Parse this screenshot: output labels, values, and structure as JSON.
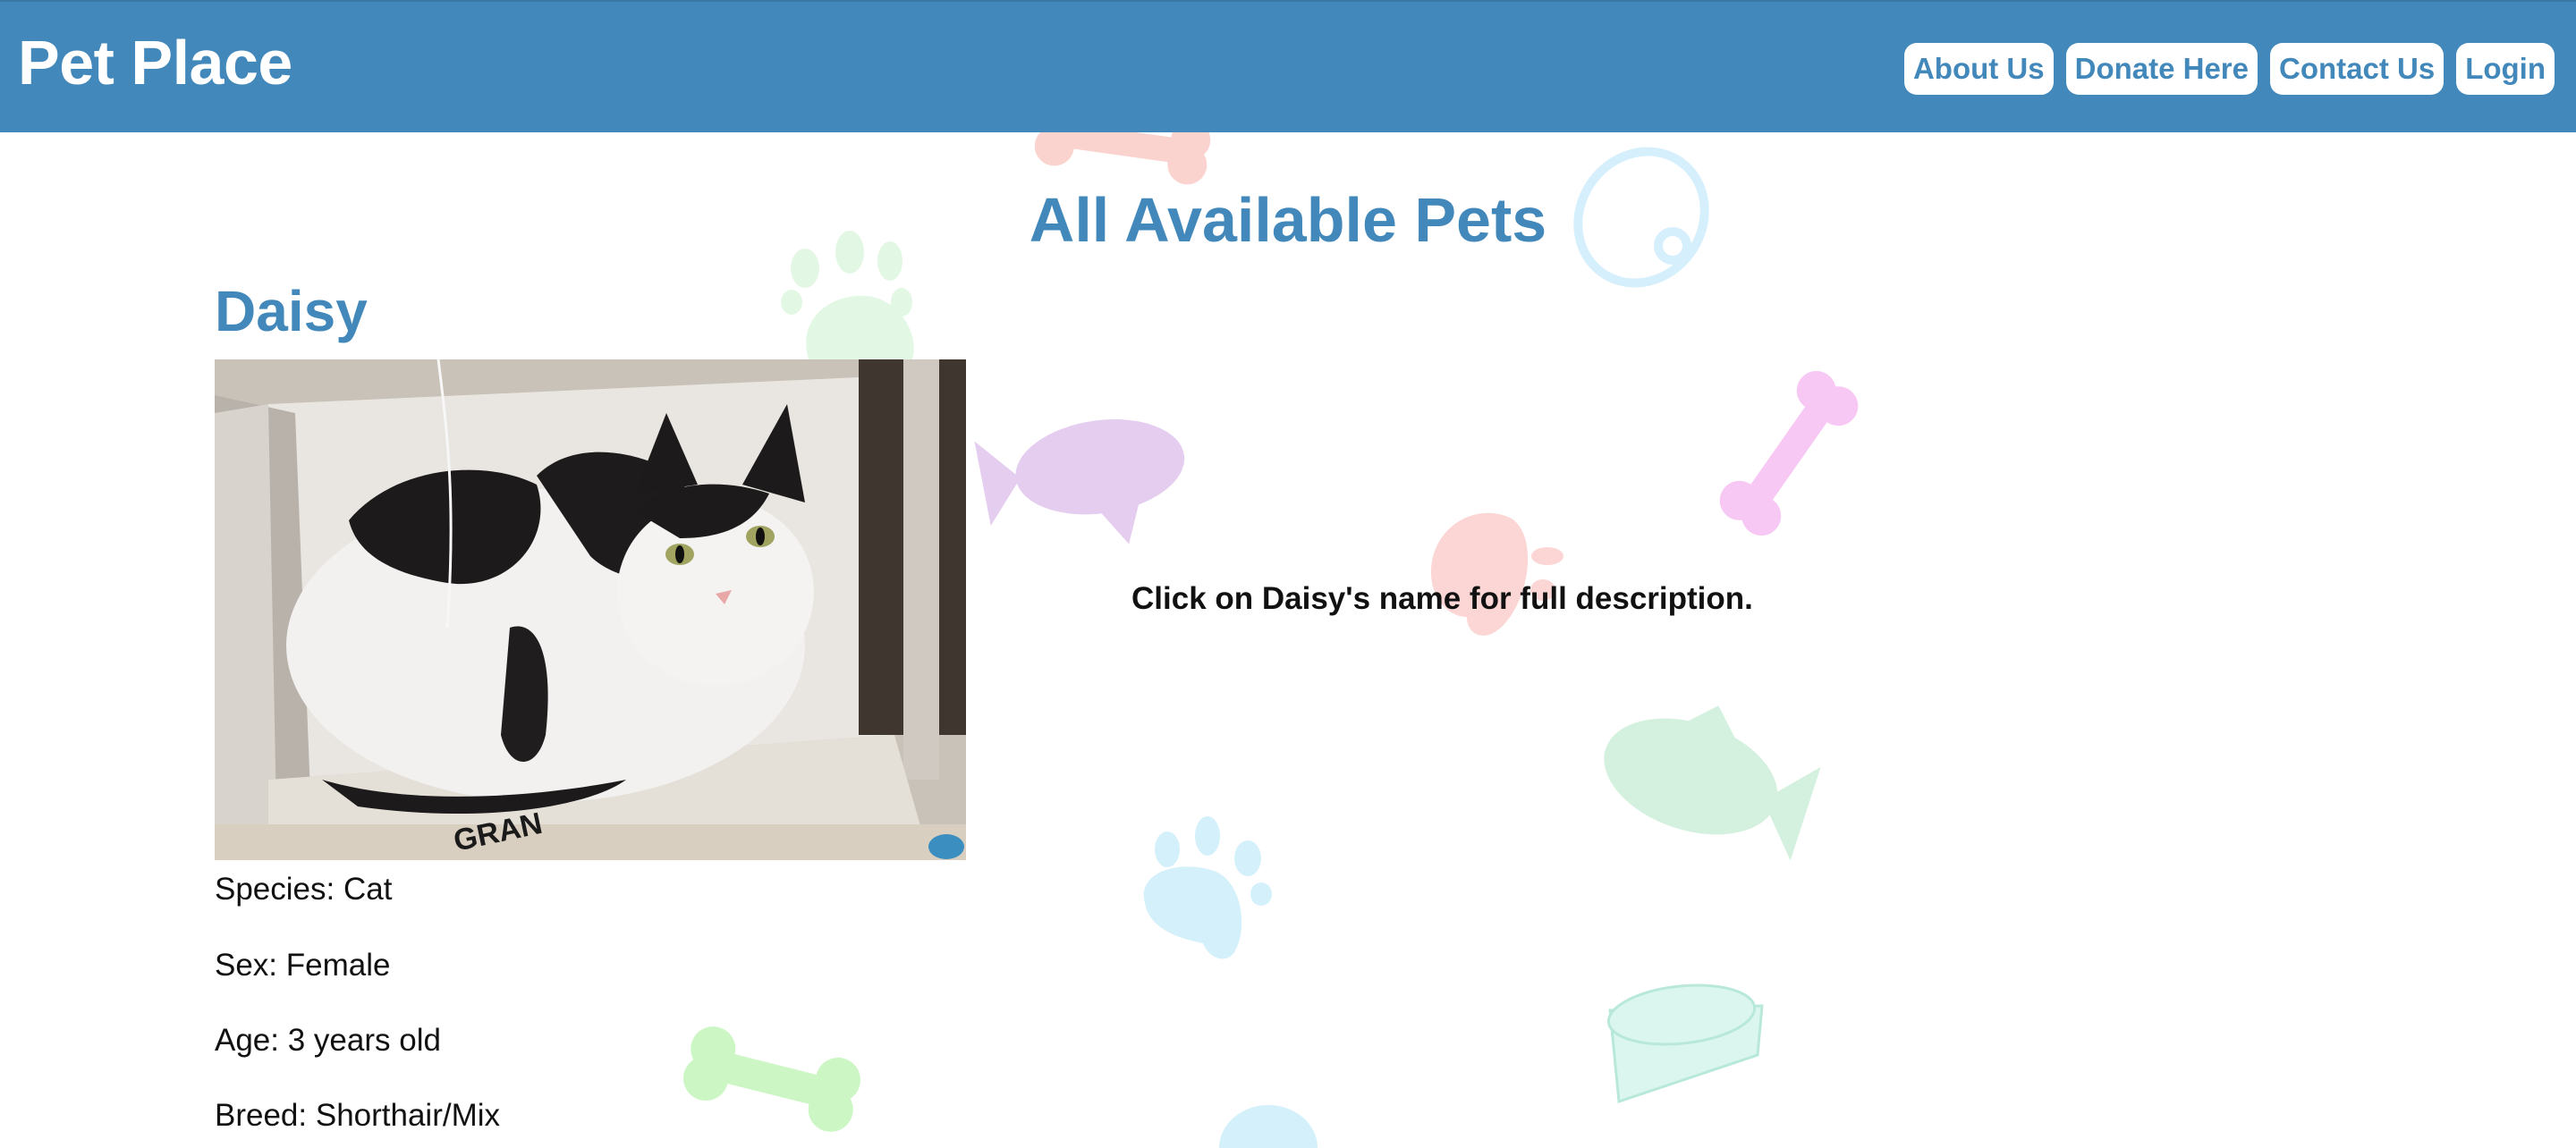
{
  "header": {
    "site_title": "Pet Place",
    "nav": {
      "about": "About Us",
      "donate": "Donate Here",
      "contact": "Contact Us",
      "login": "Login"
    }
  },
  "main": {
    "heading": "All Available Pets",
    "pet": {
      "name": "Daisy",
      "hint": "Click on Daisy's name for full description.",
      "species": "Species: Cat",
      "sex": "Sex: Female",
      "age": "Age: 3 years old",
      "breed": "Breed: Shorthair/Mix"
    }
  },
  "colors": {
    "brand_blue": "#4288ba",
    "header_text": "#ffffff",
    "body_text": "#111111"
  },
  "background_icons": [
    "bone-icon",
    "paw-icon",
    "fish-icon",
    "collar-icon",
    "bowl-icon"
  ]
}
